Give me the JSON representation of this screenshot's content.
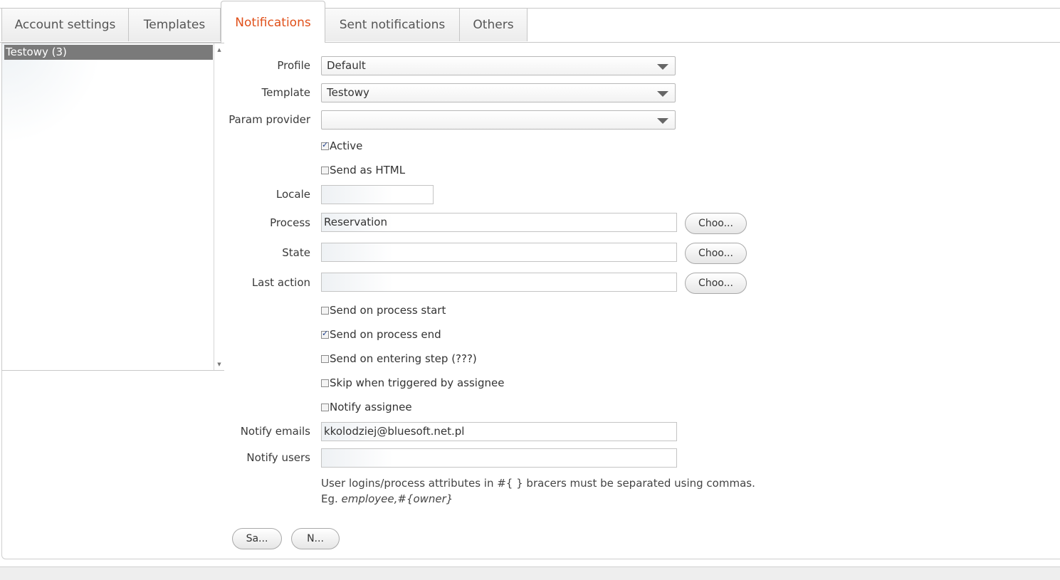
{
  "tabs": [
    {
      "label": "Account settings"
    },
    {
      "label": "Templates"
    },
    {
      "label": "Notifications"
    },
    {
      "label": "Sent notifications"
    },
    {
      "label": "Others"
    }
  ],
  "active_tab": "Notifications",
  "notification_list": [
    {
      "label": "Testowy (3)",
      "selected": true
    }
  ],
  "form": {
    "profile": {
      "label": "Profile",
      "value": "Default"
    },
    "template": {
      "label": "Template",
      "value": "Testowy"
    },
    "param_provider": {
      "label": "Param provider",
      "value": ""
    },
    "active": {
      "label": "Active",
      "checked": true
    },
    "send_as_html": {
      "label": "Send as HTML",
      "checked": false
    },
    "locale": {
      "label": "Locale",
      "value": ""
    },
    "process": {
      "label": "Process",
      "value": "Reservation",
      "button": "Choo..."
    },
    "state": {
      "label": "State",
      "value": "",
      "button": "Choo..."
    },
    "last_action": {
      "label": "Last action",
      "value": "",
      "button": "Choo..."
    },
    "send_on_process_start": {
      "label": "Send on process start",
      "checked": false
    },
    "send_on_process_end": {
      "label": "Send on process end",
      "checked": true
    },
    "send_on_entering_step": {
      "label": "Send on entering step (???)",
      "checked": false
    },
    "skip_when_triggered": {
      "label": "Skip when triggered by assignee",
      "checked": false
    },
    "notify_assignee": {
      "label": "Notify assignee",
      "checked": false
    },
    "notify_emails": {
      "label": "Notify emails",
      "value": "kkolodziej@bluesoft.net.pl"
    },
    "notify_users": {
      "label": "Notify users",
      "value": ""
    },
    "hint_line1": "User logins/process attributes in #{ } bracers must be separated using commas.",
    "hint_eg_prefix": "Eg. ",
    "hint_eg_example": "employee,#{owner}"
  },
  "buttons": {
    "save": "Sa...",
    "new": "N..."
  },
  "colors": {
    "active_tab_text": "#e0501a",
    "selected_item_bg": "#7a7a7a"
  }
}
